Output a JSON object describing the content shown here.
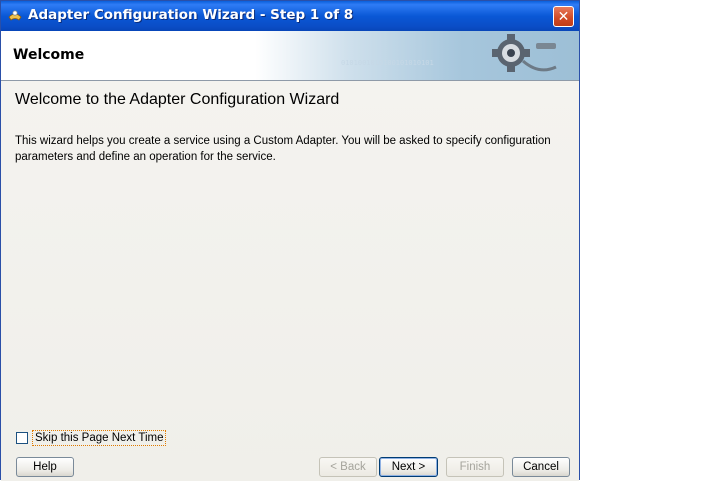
{
  "window": {
    "title": "Adapter Configuration Wizard - Step 1 of 8",
    "close_label": "✕"
  },
  "header": {
    "title": "Welcome",
    "art_binary": "0101001010100101010101"
  },
  "main": {
    "heading": "Welcome to the Adapter Configuration Wizard",
    "description": "This wizard helps you create a service using a Custom Adapter. You will be asked to specify configuration parameters and define an operation for the service."
  },
  "skip_option": {
    "label": "Skip this Page Next Time",
    "checked": false
  },
  "buttons": {
    "help": "Help",
    "back": "< Back",
    "next": "Next >",
    "finish": "Finish",
    "cancel": "Cancel"
  },
  "colors": {
    "titlebar": "#0a58d6",
    "close": "#d04a25",
    "window_bg": "#f0efea"
  }
}
